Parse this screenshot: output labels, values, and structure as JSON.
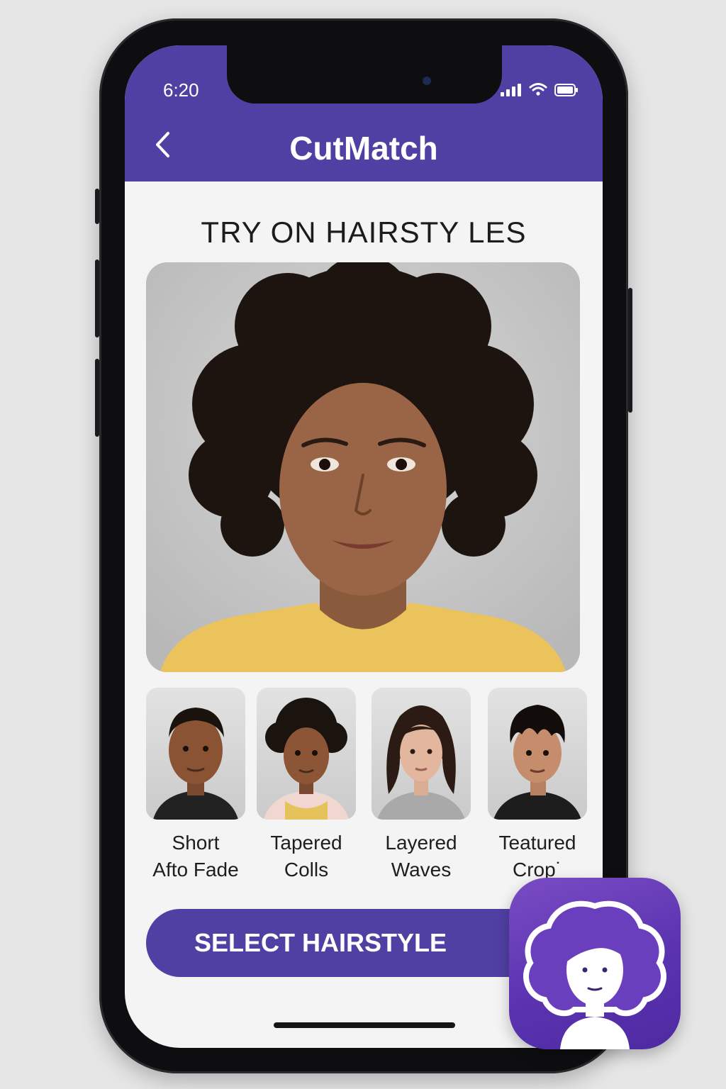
{
  "status_bar": {
    "time": "6:20"
  },
  "header": {
    "title": "CutMatch",
    "back_icon": "chevron-left-icon"
  },
  "main": {
    "heading": "TRY ON HAIRSTY LES"
  },
  "hairstyles": [
    {
      "line1": "Short",
      "line2": "Afto Fade"
    },
    {
      "line1": "Tapered",
      "line2": "Colls"
    },
    {
      "line1": "Layered",
      "line2": "Waves"
    },
    {
      "line1": "Teatured",
      "line2": "Crop˙"
    }
  ],
  "actions": {
    "select_label": "SELECT HAIRSTYLE"
  },
  "colors": {
    "brand_purple": "#5140a4",
    "icon_purple": "#6a3fbd"
  }
}
